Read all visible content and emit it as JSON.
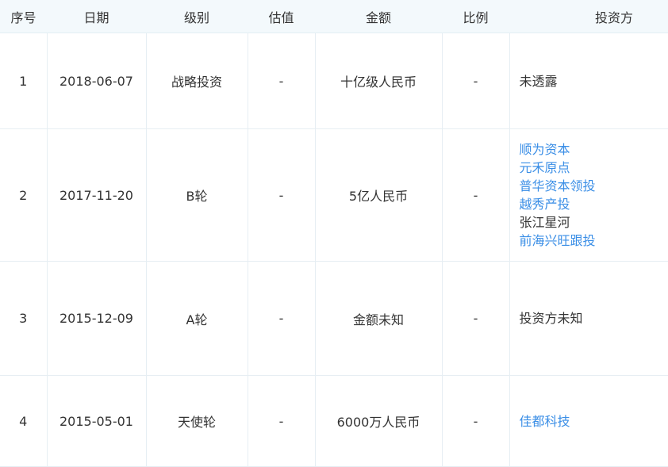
{
  "headers": [
    "序号",
    "日期",
    "级别",
    "估值",
    "金额",
    "比例",
    "投资方"
  ],
  "rows": [
    {
      "no": "1",
      "date": "2018-06-07",
      "level": "战略投资",
      "valuation": "-",
      "amount": "十亿级人民币",
      "ratio": "-",
      "investors": [
        {
          "name": "未透露",
          "link": false
        }
      ]
    },
    {
      "no": "2",
      "date": "2017-11-20",
      "level": "B轮",
      "valuation": "-",
      "amount": "5亿人民币",
      "ratio": "-",
      "investors": [
        {
          "name": "顺为资本",
          "link": true
        },
        {
          "name": "元禾原点",
          "link": true
        },
        {
          "name": "普华资本领投",
          "link": true
        },
        {
          "name": "越秀产投",
          "link": true
        },
        {
          "name": "张江星河",
          "link": false
        },
        {
          "name": "前海兴旺跟投",
          "link": true
        }
      ]
    },
    {
      "no": "3",
      "date": "2015-12-09",
      "level": "A轮",
      "valuation": "-",
      "amount": "金额未知",
      "ratio": "-",
      "investors": [
        {
          "name": "投资方未知",
          "link": false
        }
      ]
    },
    {
      "no": "4",
      "date": "2015-05-01",
      "level": "天使轮",
      "valuation": "-",
      "amount": "6000万人民币",
      "ratio": "-",
      "investors": [
        {
          "name": "佳都科技",
          "link": true
        }
      ]
    }
  ],
  "colors": {
    "link": "#3a8ee6",
    "header_bg": "#f3f9fc",
    "text": "#333333",
    "border": "#e6eef3"
  }
}
